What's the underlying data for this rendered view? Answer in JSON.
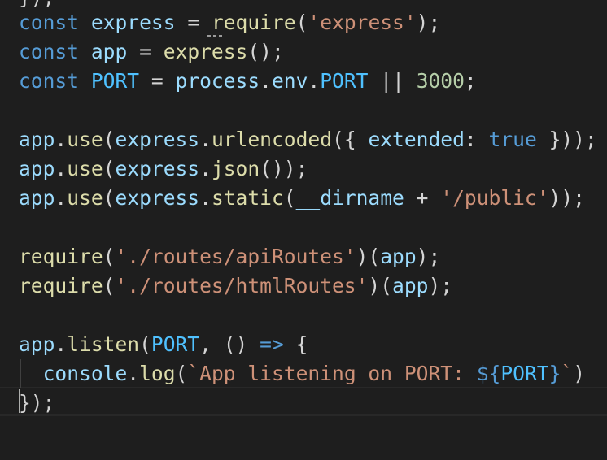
{
  "editor": {
    "partial_top_line": "});",
    "lines": [
      {
        "tokens": [
          {
            "t": "const",
            "c": "kw"
          },
          {
            "t": " ",
            "c": "op"
          },
          {
            "t": "express",
            "c": "var"
          },
          {
            "t": " = ",
            "c": "op"
          },
          {
            "t": "require",
            "c": "fn"
          },
          {
            "t": "(",
            "c": "punc"
          },
          {
            "t": "'express'",
            "c": "str"
          },
          {
            "t": ");",
            "c": "punc"
          }
        ]
      },
      {
        "tokens": [
          {
            "t": "const",
            "c": "kw"
          },
          {
            "t": " ",
            "c": "op"
          },
          {
            "t": "app",
            "c": "var"
          },
          {
            "t": " = ",
            "c": "op"
          },
          {
            "t": "express",
            "c": "fn"
          },
          {
            "t": "();",
            "c": "punc"
          }
        ]
      },
      {
        "tokens": [
          {
            "t": "const",
            "c": "kw"
          },
          {
            "t": " ",
            "c": "op"
          },
          {
            "t": "PORT",
            "c": "const"
          },
          {
            "t": " = ",
            "c": "op"
          },
          {
            "t": "process",
            "c": "var"
          },
          {
            "t": ".",
            "c": "punc"
          },
          {
            "t": "env",
            "c": "var"
          },
          {
            "t": ".",
            "c": "punc"
          },
          {
            "t": "PORT",
            "c": "const"
          },
          {
            "t": " || ",
            "c": "op"
          },
          {
            "t": "3000",
            "c": "num"
          },
          {
            "t": ";",
            "c": "punc"
          }
        ]
      },
      {
        "tokens": []
      },
      {
        "tokens": [
          {
            "t": "app",
            "c": "var"
          },
          {
            "t": ".",
            "c": "punc"
          },
          {
            "t": "use",
            "c": "fn"
          },
          {
            "t": "(",
            "c": "punc"
          },
          {
            "t": "express",
            "c": "var"
          },
          {
            "t": ".",
            "c": "punc"
          },
          {
            "t": "urlencoded",
            "c": "fn"
          },
          {
            "t": "({ ",
            "c": "punc"
          },
          {
            "t": "extended",
            "c": "var"
          },
          {
            "t": ": ",
            "c": "punc"
          },
          {
            "t": "true",
            "c": "kw"
          },
          {
            "t": " }));",
            "c": "punc"
          }
        ]
      },
      {
        "tokens": [
          {
            "t": "app",
            "c": "var"
          },
          {
            "t": ".",
            "c": "punc"
          },
          {
            "t": "use",
            "c": "fn"
          },
          {
            "t": "(",
            "c": "punc"
          },
          {
            "t": "express",
            "c": "var"
          },
          {
            "t": ".",
            "c": "punc"
          },
          {
            "t": "json",
            "c": "fn"
          },
          {
            "t": "());",
            "c": "punc"
          }
        ]
      },
      {
        "tokens": [
          {
            "t": "app",
            "c": "var"
          },
          {
            "t": ".",
            "c": "punc"
          },
          {
            "t": "use",
            "c": "fn"
          },
          {
            "t": "(",
            "c": "punc"
          },
          {
            "t": "express",
            "c": "var"
          },
          {
            "t": ".",
            "c": "punc"
          },
          {
            "t": "static",
            "c": "fn"
          },
          {
            "t": "(",
            "c": "punc"
          },
          {
            "t": "__dirname",
            "c": "var"
          },
          {
            "t": " + ",
            "c": "op"
          },
          {
            "t": "'/public'",
            "c": "str"
          },
          {
            "t": "));",
            "c": "punc"
          }
        ]
      },
      {
        "tokens": []
      },
      {
        "tokens": [
          {
            "t": "require",
            "c": "fn"
          },
          {
            "t": "(",
            "c": "punc"
          },
          {
            "t": "'./routes/apiRoutes'",
            "c": "str"
          },
          {
            "t": ")(",
            "c": "punc"
          },
          {
            "t": "app",
            "c": "var"
          },
          {
            "t": ");",
            "c": "punc"
          }
        ]
      },
      {
        "tokens": [
          {
            "t": "require",
            "c": "fn"
          },
          {
            "t": "(",
            "c": "punc"
          },
          {
            "t": "'./routes/htmlRoutes'",
            "c": "str"
          },
          {
            "t": ")(",
            "c": "punc"
          },
          {
            "t": "app",
            "c": "var"
          },
          {
            "t": ");",
            "c": "punc"
          }
        ]
      },
      {
        "tokens": []
      },
      {
        "tokens": [
          {
            "t": "app",
            "c": "var"
          },
          {
            "t": ".",
            "c": "punc"
          },
          {
            "t": "listen",
            "c": "fn"
          },
          {
            "t": "(",
            "c": "punc"
          },
          {
            "t": "PORT",
            "c": "const"
          },
          {
            "t": ", () ",
            "c": "punc"
          },
          {
            "t": "=>",
            "c": "kw"
          },
          {
            "t": " {",
            "c": "punc"
          }
        ]
      },
      {
        "tokens": [
          {
            "t": "  ",
            "c": "op"
          },
          {
            "t": "console",
            "c": "var"
          },
          {
            "t": ".",
            "c": "punc"
          },
          {
            "t": "log",
            "c": "fn"
          },
          {
            "t": "(",
            "c": "punc"
          },
          {
            "t": "`App listening on PORT: ",
            "c": "str"
          },
          {
            "t": "${",
            "c": "tpl-punc"
          },
          {
            "t": "PORT",
            "c": "const"
          },
          {
            "t": "}",
            "c": "tpl-punc"
          },
          {
            "t": "`",
            "c": "str"
          },
          {
            "t": ")",
            "c": "punc"
          }
        ]
      },
      {
        "tokens": [
          {
            "t": "});",
            "c": "punc"
          }
        ]
      }
    ]
  }
}
